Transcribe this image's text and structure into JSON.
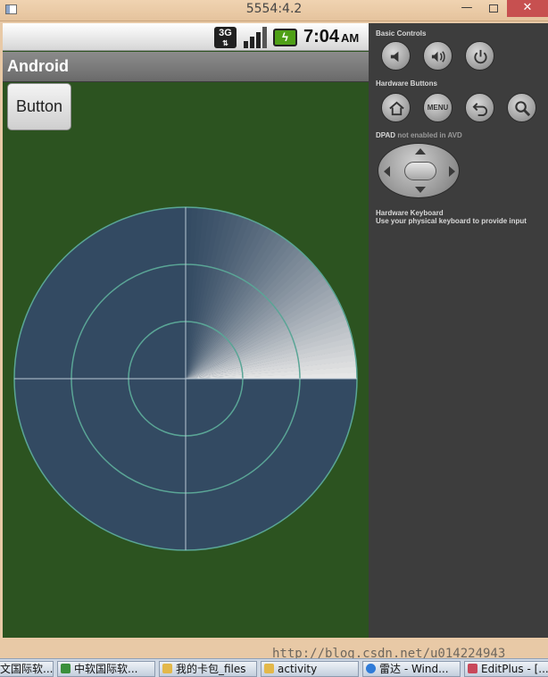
{
  "window": {
    "title": "5554:4.2",
    "minimize": "—",
    "close": "✕"
  },
  "device": {
    "statusbar": {
      "network": "3G",
      "network_arrows": "⇅",
      "battery_glyph": "ϟ",
      "time": "7:04",
      "ampm": "AM"
    },
    "app_title": "Android",
    "button_label": "Button",
    "radar": {
      "rings": 3,
      "sweep_start_deg": 270,
      "sweep_end_deg": 360,
      "colors": {
        "disc": "#334a62",
        "ring": "#5aa596",
        "crosshair": "#b9c8d4",
        "sweep_light": "#e6e6e6"
      }
    }
  },
  "panel": {
    "basic_controls": "Basic Controls",
    "hardware_buttons": "Hardware Buttons",
    "menu_label": "MENU",
    "dpad_title": "DPAD",
    "dpad_note": "not enabled in AVD",
    "keyboard_title": "Hardware Keyboard",
    "keyboard_note": "Use your physical keyboard to provide input"
  },
  "taskbar": {
    "items": [
      "文国际软...",
      "中软国际软...",
      "我的卡包_files",
      "activity",
      "雷达 - Wind...",
      "EditPlus - [..."
    ]
  },
  "watermark": "http://blog.csdn.net/u014224943"
}
